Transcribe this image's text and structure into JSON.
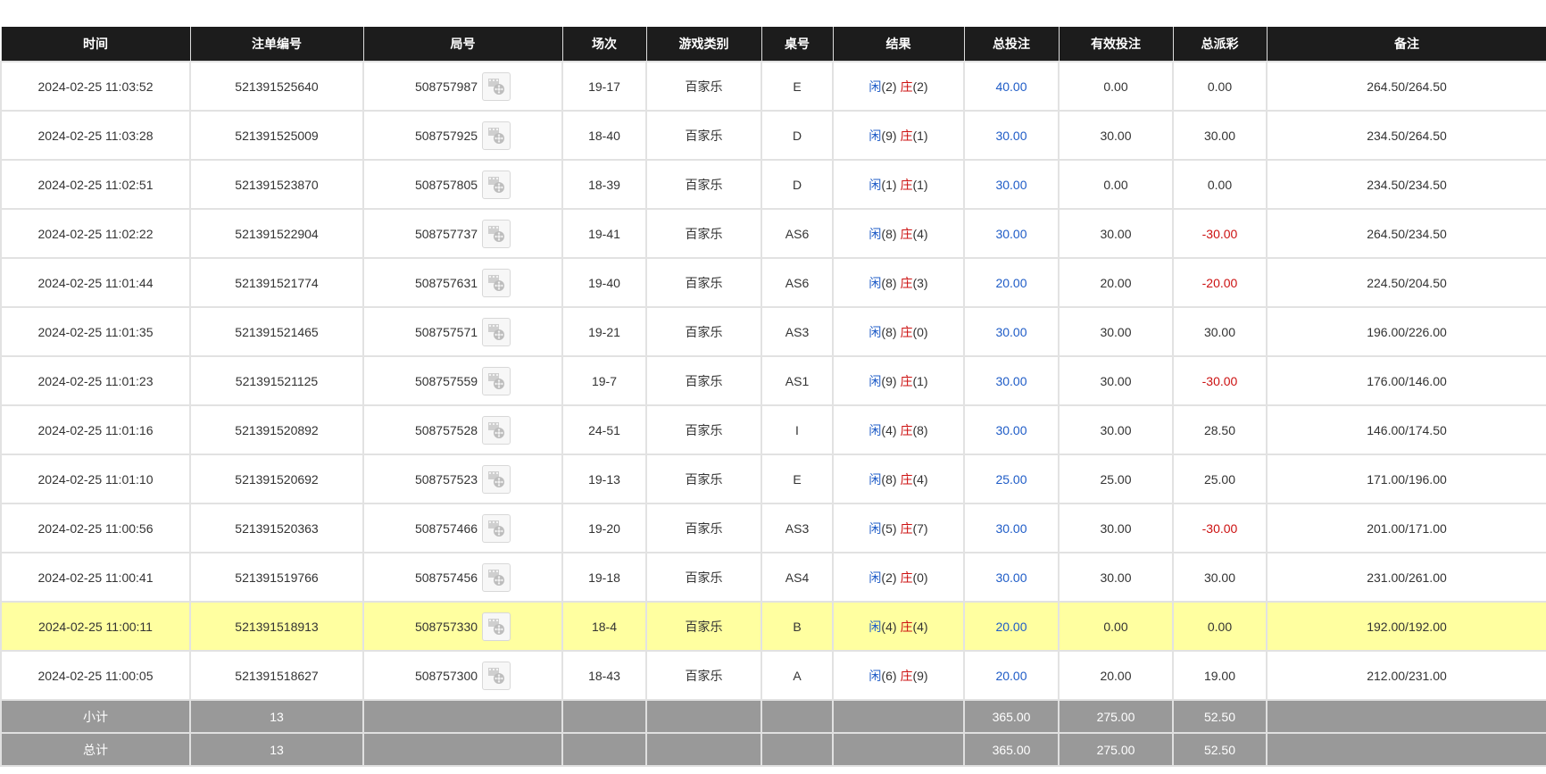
{
  "headers": [
    "时间",
    "注单编号",
    "局号",
    "场次",
    "游戏类别",
    "桌号",
    "结果",
    "总投注",
    "有效投注",
    "总派彩",
    "备注"
  ],
  "player_label": "闲",
  "banker_label": "庄",
  "rows": [
    {
      "time": "2024-02-25 11:03:52",
      "order": "521391525640",
      "round": "508757987",
      "session": "19-17",
      "game": "百家乐",
      "table": "E",
      "player": "(2)",
      "banker": "(2)",
      "total_bet": "40.00",
      "valid_bet": "0.00",
      "payout": "0.00",
      "payout_negative": false,
      "note": "264.50/264.50"
    },
    {
      "time": "2024-02-25 11:03:28",
      "order": "521391525009",
      "round": "508757925",
      "session": "18-40",
      "game": "百家乐",
      "table": "D",
      "player": "(9)",
      "banker": "(1)",
      "total_bet": "30.00",
      "valid_bet": "30.00",
      "payout": "30.00",
      "payout_negative": false,
      "note": "234.50/264.50"
    },
    {
      "time": "2024-02-25 11:02:51",
      "order": "521391523870",
      "round": "508757805",
      "session": "18-39",
      "game": "百家乐",
      "table": "D",
      "player": "(1)",
      "banker": "(1)",
      "total_bet": "30.00",
      "valid_bet": "0.00",
      "payout": "0.00",
      "payout_negative": false,
      "note": "234.50/234.50"
    },
    {
      "time": "2024-02-25 11:02:22",
      "order": "521391522904",
      "round": "508757737",
      "session": "19-41",
      "game": "百家乐",
      "table": "AS6",
      "player": "(8)",
      "banker": "(4)",
      "total_bet": "30.00",
      "valid_bet": "30.00",
      "payout": "-30.00",
      "payout_negative": true,
      "note": "264.50/234.50"
    },
    {
      "time": "2024-02-25 11:01:44",
      "order": "521391521774",
      "round": "508757631",
      "session": "19-40",
      "game": "百家乐",
      "table": "AS6",
      "player": "(8)",
      "banker": "(3)",
      "total_bet": "20.00",
      "valid_bet": "20.00",
      "payout": "-20.00",
      "payout_negative": true,
      "note": "224.50/204.50"
    },
    {
      "time": "2024-02-25 11:01:35",
      "order": "521391521465",
      "round": "508757571",
      "session": "19-21",
      "game": "百家乐",
      "table": "AS3",
      "player": "(8)",
      "banker": "(0)",
      "total_bet": "30.00",
      "valid_bet": "30.00",
      "payout": "30.00",
      "payout_negative": false,
      "note": "196.00/226.00"
    },
    {
      "time": "2024-02-25 11:01:23",
      "order": "521391521125",
      "round": "508757559",
      "session": "19-7",
      "game": "百家乐",
      "table": "AS1",
      "player": "(9)",
      "banker": "(1)",
      "total_bet": "30.00",
      "valid_bet": "30.00",
      "payout": "-30.00",
      "payout_negative": true,
      "note": "176.00/146.00"
    },
    {
      "time": "2024-02-25 11:01:16",
      "order": "521391520892",
      "round": "508757528",
      "session": "24-51",
      "game": "百家乐",
      "table": "I",
      "player": "(4)",
      "banker": "(8)",
      "total_bet": "30.00",
      "valid_bet": "30.00",
      "payout": "28.50",
      "payout_negative": false,
      "note": "146.00/174.50"
    },
    {
      "time": "2024-02-25 11:01:10",
      "order": "521391520692",
      "round": "508757523",
      "session": "19-13",
      "game": "百家乐",
      "table": "E",
      "player": "(8)",
      "banker": "(4)",
      "total_bet": "25.00",
      "valid_bet": "25.00",
      "payout": "25.00",
      "payout_negative": false,
      "note": "171.00/196.00"
    },
    {
      "time": "2024-02-25 11:00:56",
      "order": "521391520363",
      "round": "508757466",
      "session": "19-20",
      "game": "百家乐",
      "table": "AS3",
      "player": "(5)",
      "banker": "(7)",
      "total_bet": "30.00",
      "valid_bet": "30.00",
      "payout": "-30.00",
      "payout_negative": true,
      "note": "201.00/171.00"
    },
    {
      "time": "2024-02-25 11:00:41",
      "order": "521391519766",
      "round": "508757456",
      "session": "19-18",
      "game": "百家乐",
      "table": "AS4",
      "player": "(2)",
      "banker": "(0)",
      "total_bet": "30.00",
      "valid_bet": "30.00",
      "payout": "30.00",
      "payout_negative": false,
      "note": "231.00/261.00"
    },
    {
      "time": "2024-02-25 11:00:11",
      "order": "521391518913",
      "round": "508757330",
      "session": "18-4",
      "game": "百家乐",
      "table": "B",
      "player": "(4)",
      "banker": "(4)",
      "total_bet": "20.00",
      "valid_bet": "0.00",
      "payout": "0.00",
      "payout_negative": false,
      "note": "192.00/192.00",
      "highlighted": true
    },
    {
      "time": "2024-02-25 11:00:05",
      "order": "521391518627",
      "round": "508757300",
      "session": "18-43",
      "game": "百家乐",
      "table": "A",
      "player": "(6)",
      "banker": "(9)",
      "total_bet": "20.00",
      "valid_bet": "20.00",
      "payout": "19.00",
      "payout_negative": false,
      "note": "212.00/231.00"
    }
  ],
  "summary": [
    {
      "label": "小计",
      "count": "13",
      "total_bet": "365.00",
      "valid_bet": "275.00",
      "payout": "52.50"
    },
    {
      "label": "总计",
      "count": "13",
      "total_bet": "365.00",
      "valid_bet": "275.00",
      "payout": "52.50"
    }
  ],
  "colors": {
    "header_bg": "#1c1c1c",
    "highlight_row": "#ffffa0",
    "summary_bg": "#999999",
    "player": "#1f5cc7",
    "banker": "#cc1111"
  },
  "icons": {
    "replay": "film-reel-icon"
  }
}
